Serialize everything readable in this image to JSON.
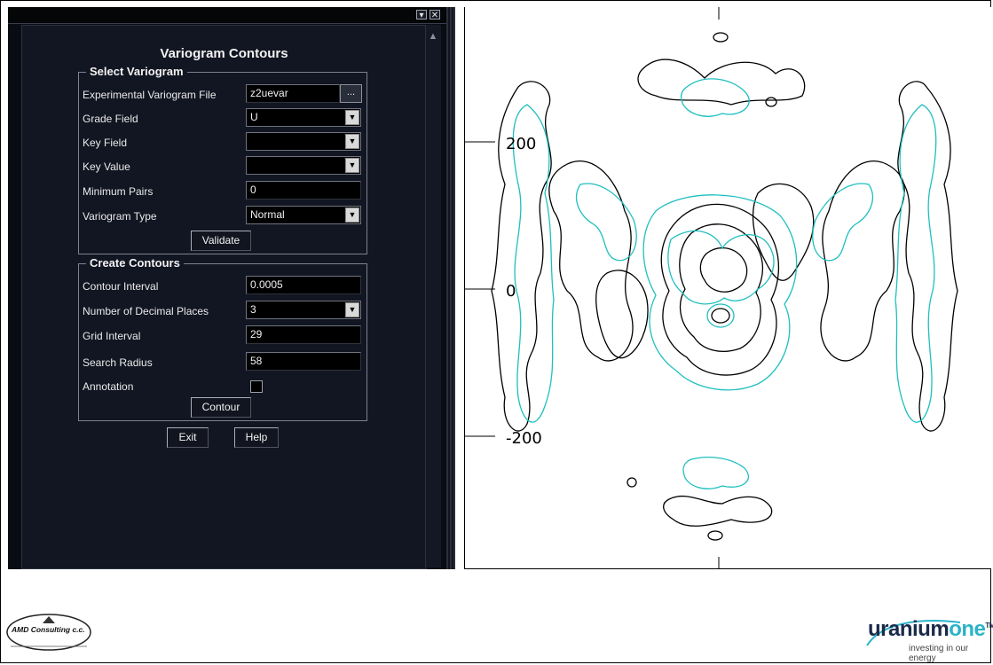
{
  "dialog": {
    "title": "Variogram Contours",
    "select_variogram": {
      "group_title": "Select Variogram",
      "experimental_file_label": "Experimental Variogram File",
      "experimental_file_value": "z2uevar",
      "browse_label": "...",
      "grade_field_label": "Grade Field",
      "grade_field_value": "U",
      "key_field_label": "Key Field",
      "key_field_value": "",
      "key_value_label": "Key Value",
      "key_value_value": "",
      "minimum_pairs_label": "Minimum Pairs",
      "minimum_pairs_value": "0",
      "variogram_type_label": "Variogram Type",
      "variogram_type_value": "Normal",
      "validate_label": "Validate"
    },
    "create_contours": {
      "group_title": "Create Contours",
      "contour_interval_label": "Contour Interval",
      "contour_interval_value": "0.0005",
      "decimal_places_label": "Number of Decimal Places",
      "decimal_places_value": "3",
      "grid_interval_label": "Grid Interval",
      "grid_interval_value": "29",
      "search_radius_label": "Search Radius",
      "search_radius_value": "58",
      "annotation_label": "Annotation",
      "annotation_checked": false,
      "contour_label": "Contour"
    },
    "exit_label": "Exit",
    "help_label": "Help"
  },
  "window_controls": {
    "restore_glyph": "▾",
    "close_glyph": "✕"
  },
  "plot": {
    "axis_ticks": [
      "200",
      "0",
      "-200"
    ],
    "colors": {
      "contour_primary": "#000000",
      "contour_secondary": "#1fbfbf"
    }
  },
  "logos": {
    "amd": {
      "name": "AMD Consulting c.c."
    },
    "uranium_one": {
      "word_part1": "uranium",
      "word_part2": "one",
      "trademark": "TM",
      "tagline": "investing in our energy",
      "colors": {
        "part1": "#1a2a4a",
        "part2": "#2bb3c9"
      }
    }
  }
}
